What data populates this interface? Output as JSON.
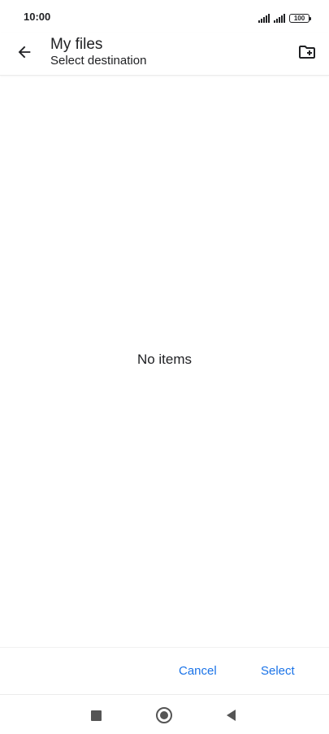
{
  "status_bar": {
    "time": "10:00",
    "battery": "100"
  },
  "app_bar": {
    "title": "My files",
    "subtitle": "Select destination",
    "back_icon": "arrow-back-icon",
    "new_folder_icon": "create-new-folder-icon"
  },
  "content": {
    "empty_message": "No items"
  },
  "actions": {
    "cancel_label": "Cancel",
    "select_label": "Select"
  },
  "colors": {
    "accent": "#1a73e8",
    "text": "#202124"
  }
}
